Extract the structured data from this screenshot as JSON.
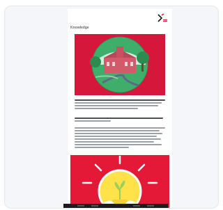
{
  "document": {
    "title": "Knowledge",
    "colors": {
      "brand_red": "#d5173b",
      "promo_red": "#e31937",
      "circle_green": "#3fae6a",
      "bulb_yellow": "#ffe14a"
    },
    "icons": [
      "brand-logo-icon",
      "campus-illustration",
      "lightbulb-illustration"
    ]
  }
}
